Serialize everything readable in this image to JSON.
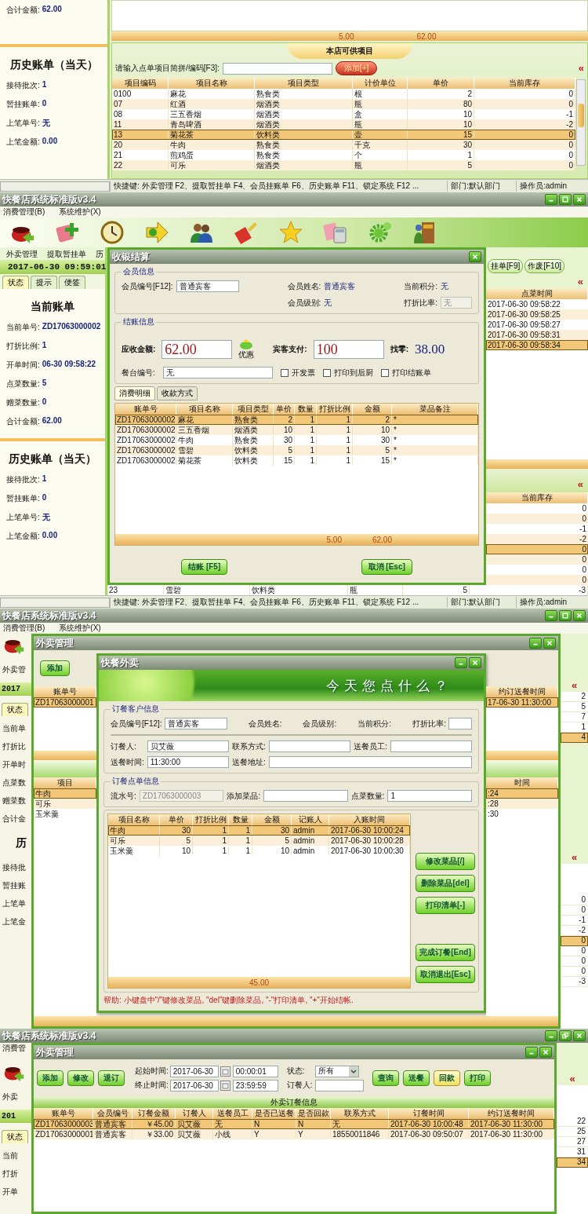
{
  "screen_1": {
    "current_bill": {
      "stats": [
        {
          "label": "合计金额:",
          "value": "62.00"
        }
      ]
    },
    "history": {
      "title": "历史账单（当天）",
      "stats": [
        {
          "label": "接待批次:",
          "value": "1"
        },
        {
          "label": "暂挂账单:",
          "value": "0"
        },
        {
          "label": "上笔单号:",
          "value": "无"
        },
        {
          "label": "上笔金额:",
          "value": "0.00"
        }
      ]
    },
    "order_totals": [
      "5.00",
      "62.00"
    ],
    "menu_items": {
      "title": "本店可供项目",
      "search_label": "请输入点单项目简拼/编码[F3]:",
      "add_button": "添加[+]",
      "collapse": "«",
      "columns": [
        "项目编码",
        "项目名称",
        "项目类型",
        "计价单位",
        "单价",
        "当前库存"
      ],
      "rows": [
        {
          "cells": [
            "0100",
            "麻花",
            "熟食类",
            "根",
            "2",
            "0"
          ],
          "selected": false
        },
        {
          "cells": [
            "07",
            "红酒",
            "烟酒类",
            "瓶",
            "80",
            "0"
          ],
          "selected": false
        },
        {
          "cells": [
            "08",
            "三五香烟",
            "烟酒类",
            "盒",
            "10",
            "-1"
          ],
          "selected": false
        },
        {
          "cells": [
            "11",
            "青岛啤酒",
            "烟酒类",
            "瓶",
            "10",
            "-2"
          ],
          "selected": false
        },
        {
          "cells": [
            "13",
            "菊花茶",
            "饮料类",
            "壶",
            "15",
            "0"
          ],
          "selected": true
        },
        {
          "cells": [
            "20",
            "牛肉",
            "熟食类",
            "千克",
            "30",
            "0"
          ],
          "selected": false
        },
        {
          "cells": [
            "21",
            "煎鸡蛋",
            "熟食类",
            "个",
            "1",
            "0"
          ],
          "selected": false
        },
        {
          "cells": [
            "22",
            "可乐",
            "烟酒类",
            "瓶",
            "5",
            "0"
          ],
          "selected": false
        }
      ]
    },
    "status_bar": {
      "shortcuts": "快捷键: 外卖管理 F2、提取暂挂单 F4、会员挂账单 F6、历史账单 F11、锁定系统 F12 ...",
      "department": "部门:默认部门",
      "operator": "操作员:admin"
    }
  },
  "screen_2": {
    "window": {
      "title": "快餐店系统标准版v3.4"
    },
    "menu": [
      "消费管理(B)",
      "系统维护(X)"
    ],
    "toolbar_labels": [
      "外卖管理",
      "提取暂挂单",
      "历"
    ],
    "clock": "2017-06-30 09:59:01",
    "side_tabs": [
      {
        "label": "状态",
        "selected": true
      },
      {
        "label": "提示",
        "selected": false
      },
      {
        "label": "便签",
        "selected": false
      }
    ],
    "current_bill": {
      "title": "当前账单",
      "stats": [
        {
          "label": "当前单号:",
          "value": "ZD17063000002"
        },
        {
          "label": "打折比例:",
          "value": "1"
        },
        {
          "label": "开单时间:",
          "value": "06-30 09:58:22"
        },
        {
          "label": "点菜数量:",
          "value": "5"
        },
        {
          "label": "赠菜数量:",
          "value": "0"
        },
        {
          "label": "合计金额:",
          "value": "62.00"
        }
      ]
    },
    "history": {
      "title": "历史账单（当天）",
      "stats": [
        {
          "label": "接待批次:",
          "value": "1"
        },
        {
          "label": "暂挂账单:",
          "value": "0"
        },
        {
          "label": "上笔单号:",
          "value": "无"
        },
        {
          "label": "上笔金额:",
          "value": "0.00"
        }
      ]
    },
    "bill_actions": [
      "挂单[F9]",
      "作废[F10]"
    ],
    "collapse": [
      "«",
      "«"
    ],
    "order_times": {
      "columns": [
        "点菜时间"
      ],
      "rows": [
        {
          "cells": [
            "2017-06-30 09:58:22"
          ],
          "selected": false
        },
        {
          "cells": [
            "2017-06-30 09:58:25"
          ],
          "selected": false
        },
        {
          "cells": [
            "2017-06-30 09:58:27"
          ],
          "selected": false
        },
        {
          "cells": [
            "2017-06-30 09:58:31"
          ],
          "selected": false
        },
        {
          "cells": [
            "2017-06-30 09:58:34"
          ],
          "selected": true
        }
      ]
    },
    "stock": {
      "columns": [
        "当前库存"
      ],
      "rows": [
        {
          "cells": [
            "0"
          ],
          "selected": false
        },
        {
          "cells": [
            "0"
          ],
          "selected": false
        },
        {
          "cells": [
            "-1"
          ],
          "selected": false
        },
        {
          "cells": [
            "-2"
          ],
          "selected": false
        },
        {
          "cells": [
            "0"
          ],
          "selected": true
        },
        {
          "cells": [
            "0"
          ],
          "selected": false
        },
        {
          "cells": [
            "0"
          ],
          "selected": false
        },
        {
          "cells": [
            "0"
          ],
          "selected": false
        }
      ]
    },
    "menu_row": {
      "cells": [
        "23",
        "雪碧",
        "饮料类",
        "瓶",
        "5",
        "-3"
      ],
      "selected": false
    },
    "status_bar": {
      "shortcuts": "快捷键: 外卖管理 F2、提取暂挂单 F4、会员挂账单 F6、历史账单 F11、锁定系统 F12 ...",
      "department": "部门:默认部门",
      "operator": "操作员:admin"
    },
    "checkout_dialog": {
      "title": "收银结算",
      "member": {
        "title": "会员信息",
        "id_label": "会员编号[F12]:",
        "id": "普通宾客",
        "name_label": "会员姓名:",
        "name": "普通宾客",
        "level_label": "会员级别:",
        "level": "无",
        "points_label": "当前积分:",
        "points": "无",
        "discount_label": "打折比率:",
        "discount": "无"
      },
      "payment": {
        "title": "结账信息",
        "due_label": "应收金额:",
        "due": "62.00",
        "discount_button": "优惠",
        "paid_label": "宾客支付:",
        "paid": "100",
        "change_label": "找零:",
        "change": "38.00",
        "table_label": "餐台编号:",
        "table": "无",
        "options": [
          {
            "label": "开发票",
            "checked": false
          },
          {
            "label": "打印到后厨",
            "checked": false
          },
          {
            "label": "打印结账单",
            "checked": false
          }
        ]
      },
      "tabs": [
        {
          "label": "消费明细",
          "selected": true
        },
        {
          "label": "收款方式",
          "selected": false
        }
      ],
      "items": {
        "columns": [
          "账单号",
          "项目名称",
          "项目类型",
          "单价",
          "数量",
          "打折比例",
          "金额",
          "菜品备注"
        ],
        "rows": [
          {
            "cells": [
              "ZD17063000002",
              "麻花",
              "熟食类",
              "2",
              "1",
              "1",
              "2",
              "*"
            ],
            "selected": true
          },
          {
            "cells": [
              "ZD17063000002",
              "三五香烟",
              "烟酒类",
              "10",
              "1",
              "1",
              "10",
              "*"
            ],
            "selected": false
          },
          {
            "cells": [
              "ZD17063000002",
              "牛肉",
              "熟食类",
              "30",
              "1",
              "1",
              "30",
              "*"
            ],
            "selected": false
          },
          {
            "cells": [
              "ZD17063000002",
              "雪碧",
              "饮料类",
              "5",
              "1",
              "1",
              "5",
              "*"
            ],
            "selected": false
          },
          {
            "cells": [
              "ZD17063000002",
              "菊花茶",
              "饮料类",
              "15",
              "1",
              "1",
              "15",
              "*"
            ],
            "selected": false
          }
        ],
        "totals": [
          "5.00",
          "62.00"
        ]
      },
      "buttons": [
        "结账 [F5]",
        "取消 [Esc]"
      ]
    }
  },
  "screen_3": {
    "window": {
      "title": "快餐店系统标准版v3.4"
    },
    "menu": [
      "消费管理(B)",
      "系统维护(X)"
    ],
    "side": {
      "toolbar_label": "外卖管",
      "clock": "2017",
      "tab": "状态",
      "fragments": [
        {
          "kind": "stat",
          "text": "当前单"
        },
        {
          "kind": "stat",
          "text": "打折比"
        },
        {
          "kind": "stat",
          "text": "开单时"
        },
        {
          "kind": "stat",
          "text": "点菜数"
        },
        {
          "kind": "stat",
          "text": "赠菜数"
        },
        {
          "kind": "stat",
          "text": "合计金"
        },
        {
          "kind": "heading",
          "text": "历"
        },
        {
          "kind": "stat",
          "text": "接待批"
        },
        {
          "kind": "stat",
          "text": "暂挂账"
        },
        {
          "kind": "stat",
          "text": "上笔单"
        },
        {
          "kind": "stat",
          "text": "上笔金"
        }
      ]
    },
    "right_side": {
      "collapse": [
        "«",
        "«"
      ],
      "times": [
        {
          "text": "2",
          "selected": false
        },
        {
          "text": "5",
          "selected": false
        },
        {
          "text": "7",
          "selected": false
        },
        {
          "text": "1",
          "selected": false
        },
        {
          "text": "4",
          "selected": true
        }
      ],
      "stock": [
        {
          "text": "0",
          "selected": false
        },
        {
          "text": "0",
          "selected": false
        },
        {
          "text": "-1",
          "selected": false
        },
        {
          "text": "-2",
          "selected": false
        },
        {
          "text": "0",
          "selected": true
        },
        {
          "text": "0",
          "selected": false
        },
        {
          "text": "0",
          "selected": false
        },
        {
          "text": "0",
          "selected": false
        },
        {
          "text": "-3",
          "selected": false
        }
      ]
    },
    "takeout_manager": {
      "title": "外卖管理",
      "add_button": "添加",
      "orders_left": {
        "columns": [
          "账单号"
        ],
        "rows": [
          {
            "cells": [
              "ZD17063000001"
            ],
            "selected": true
          }
        ]
      },
      "orders_right": {
        "columns": [
          "约订送餐时间"
        ],
        "rows": [
          {
            "cells": [
              "17-06-30 11:30:00"
            ],
            "selected": true
          }
        ]
      },
      "items_left": {
        "columns": [
          "项目"
        ],
        "rows": [
          {
            "cells": [
              "牛肉"
            ],
            "selected": true
          },
          {
            "cells": [
              "可乐"
            ],
            "selected": false
          },
          {
            "cells": [
              "玉米羹"
            ],
            "selected": false
          }
        ]
      },
      "items_right": {
        "columns": [
          "时间"
        ],
        "rows": [
          {
            "cells": [
              ":24"
            ],
            "selected": true
          },
          {
            "cells": [
              ":28"
            ],
            "selected": false
          },
          {
            "cells": [
              ":30"
            ],
            "selected": false
          }
        ]
      }
    },
    "takeout_dialog": {
      "title": "快餐外卖",
      "banner": "今天您点什么？",
      "customer": {
        "title": "订餐客户信息",
        "row": [
          {
            "kind": "input",
            "label": "会员编号[F12]:",
            "value": "普通宾客"
          },
          {
            "kind": "text",
            "label": "会员姓名:"
          },
          {
            "kind": "text",
            "label": "会员级别:"
          },
          {
            "kind": "text",
            "label": "当前积分:"
          },
          {
            "kind": "input",
            "label": "打折比率:"
          }
        ],
        "fields": [
          {
            "label": "订餐人:",
            "value": "贝艾薇"
          },
          {
            "label": "联系方式:"
          },
          {
            "label": "送餐员工:"
          },
          {
            "label": "送餐时间:",
            "value": "11:30:00"
          },
          {
            "label": "送餐地址:"
          }
        ]
      },
      "order": {
        "title": "订餐点单信息",
        "fields": [
          {
            "label": "流水号:",
            "value": "ZD17063000003",
            "disabled": true
          },
          {
            "label": "添加菜品:",
            "disabled": false
          },
          {
            "label": "点菜数量:",
            "value": "1",
            "disabled": false
          }
        ]
      },
      "items": {
        "columns": [
          "项目名称",
          "单价",
          "打折比例",
          "数量",
          "金额",
          "记账人",
          "入账时间"
        ],
        "rows": [
          {
            "cells": [
              "牛肉",
              "30",
              "1",
              "1",
              "30",
              "admin",
              "2017-06-30 10:00:24"
            ],
            "selected": true
          },
          {
            "cells": [
              "可乐",
              "5",
              "1",
              "1",
              "5",
              "admin",
              "2017-06-30 10:00:28"
            ],
            "selected": false
          },
          {
            "cells": [
              "玉米羹",
              "10",
              "1",
              "1",
              "10",
              "admin",
              "2017-06-30 10:00:30"
            ],
            "selected": false
          }
        ],
        "total": "45.00"
      },
      "buttons": [
        "修改菜品[/]",
        "删除菜品[del]",
        "打印清单[-]",
        "完成订餐[End]",
        "取消退出[Esc]"
      ],
      "help": "帮助: 小键盘中\"/\"键修改菜品, \"del\"键删除菜品, \"-\"打印清单, \"+\"开始结帐."
    }
  },
  "screen_4": {
    "window": {
      "title": "快餐店系统标准版v3.4"
    },
    "side": {
      "menu": "消费管",
      "toolbar_label": "外卖",
      "clock": "201",
      "tab": "状态",
      "fragments": [
        {
          "kind": "stat",
          "text": "当前"
        },
        {
          "kind": "stat",
          "text": "打折"
        },
        {
          "kind": "stat",
          "text": "开单"
        }
      ]
    },
    "right_side": {
      "collapse": "«",
      "times": [
        {
          "text": "22",
          "selected": false
        },
        {
          "text": "25",
          "selected": false
        },
        {
          "text": "27",
          "selected": false
        },
        {
          "text": "31",
          "selected": false
        },
        {
          "text": "34",
          "selected": true
        }
      ]
    },
    "takeout_manager": {
      "title": "外卖管理",
      "actions": [
        "添加",
        "修改",
        "退订"
      ],
      "start_label": "起始时间:",
      "start_date": "2017-06-30",
      "start_time": "00:00:01",
      "end_label": "终止时间:",
      "end_date": "2017-06-30",
      "end_time": "23:59:59",
      "status_label": "状态:",
      "status": "所有",
      "orderer_label": "订餐人:",
      "search_buttons": [
        {
          "label": "查询",
          "selected": false
        },
        {
          "label": "送餐",
          "selected": false
        },
        {
          "label": "回款",
          "selected": true
        },
        {
          "label": "打印",
          "selected": false
        }
      ],
      "orders": {
        "title": "外卖订餐信息",
        "columns": [
          "账单号",
          "会员编号",
          "订餐金额",
          "订餐人",
          "送餐员工",
          "是否已送餐",
          "是否回款",
          "联系方式",
          "订餐时间",
          "约订送餐时间"
        ],
        "rows": [
          {
            "cells": [
              "ZD17063000003",
              "普通宾客",
              "￥45.00",
              "贝艾薇",
              "无",
              "N",
              "N",
              "无",
              "2017-06-30 10:00:48",
              "2017-06-30 11:30:00"
            ],
            "selected": true
          },
          {
            "cells": [
              "ZD17063000001",
              "普通宾客",
              "￥33.00",
              "贝艾薇",
              "小线",
              "Y",
              "Y",
              "18550011846",
              "2017-06-30 09:50:07",
              "2017-06-30 11:30:00"
            ],
            "selected": false
          }
        ]
      }
    }
  }
}
